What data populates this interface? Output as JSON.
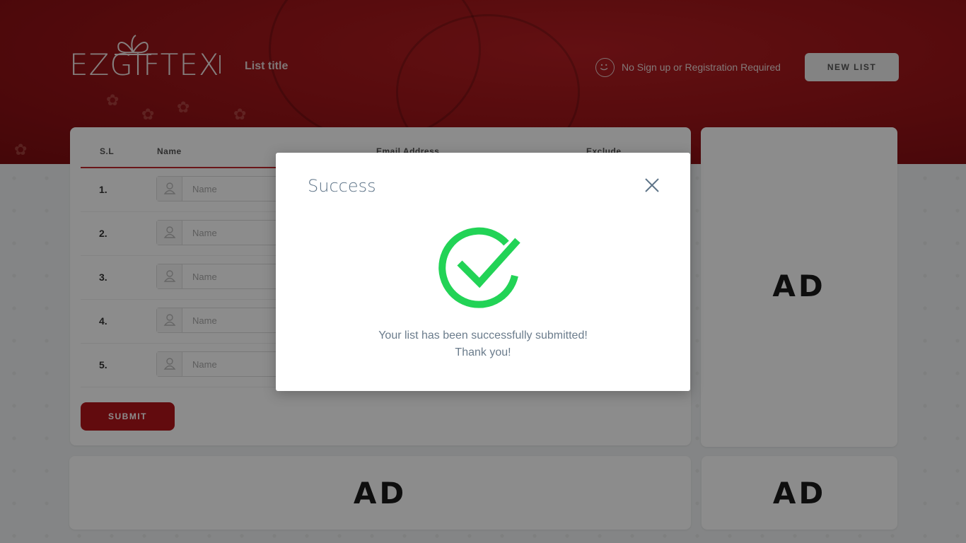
{
  "header": {
    "logo_text": "EZGIFTEX",
    "list_title": "List title",
    "no_signup": "No Sign up or Registration Required",
    "new_list_label": "NEW LIST"
  },
  "table": {
    "headers": [
      "S.L",
      "Name",
      "Email Address",
      "Exclude"
    ],
    "rows": [
      {
        "num": "1.",
        "name_placeholder": "Name"
      },
      {
        "num": "2.",
        "name_placeholder": "Name"
      },
      {
        "num": "3.",
        "name_placeholder": "Name"
      },
      {
        "num": "4.",
        "name_placeholder": "Name"
      },
      {
        "num": "5.",
        "name_placeholder": "Name"
      }
    ],
    "submit_label": "SUBMIT"
  },
  "ads": {
    "right": "AD",
    "bottom": "AD",
    "bottom_small": "AD"
  },
  "modal": {
    "title": "Success",
    "message_line1": "Your list has been successfully submitted!",
    "message_line2": "Thank you!"
  },
  "colors": {
    "brand_red": "#b3141a",
    "success_green": "#22d356",
    "modal_title": "#5e7488"
  },
  "icons": {
    "smile": "smile-icon",
    "close": "close-icon",
    "check": "check-circle-icon",
    "user": "user-icon"
  }
}
